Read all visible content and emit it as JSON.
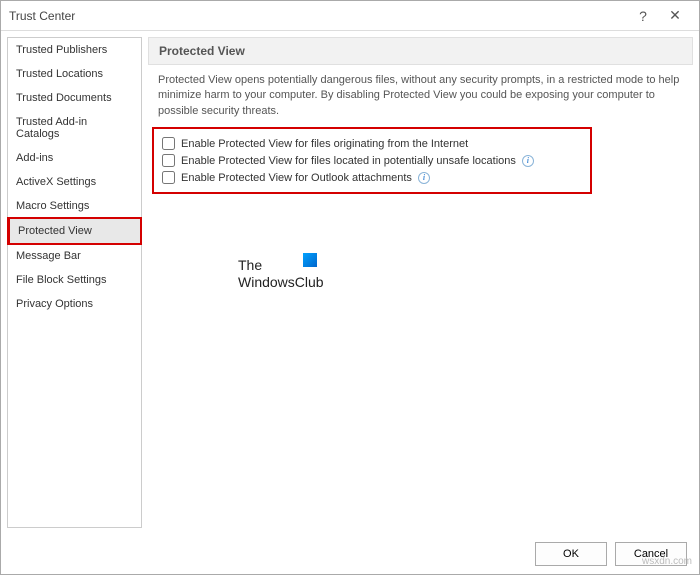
{
  "window": {
    "title": "Trust Center",
    "help": "?",
    "close": "✕"
  },
  "sidebar": {
    "items": [
      {
        "label": "Trusted Publishers"
      },
      {
        "label": "Trusted Locations"
      },
      {
        "label": "Trusted Documents"
      },
      {
        "label": "Trusted Add-in Catalogs"
      },
      {
        "label": "Add-ins"
      },
      {
        "label": "ActiveX Settings"
      },
      {
        "label": "Macro Settings"
      },
      {
        "label": "Protected View"
      },
      {
        "label": "Message Bar"
      },
      {
        "label": "File Block Settings"
      },
      {
        "label": "Privacy Options"
      }
    ],
    "selectedIndex": 7
  },
  "section": {
    "title": "Protected View",
    "description": "Protected View opens potentially dangerous files, without any security prompts, in a restricted mode to help minimize harm to your computer. By disabling Protected View you could be exposing your computer to possible security threats.",
    "options": [
      {
        "label": "Enable Protected View for files originating from the Internet",
        "checked": false,
        "info": false
      },
      {
        "label": "Enable Protected View for files located in potentially unsafe locations",
        "checked": false,
        "info": true
      },
      {
        "label": "Enable Protected View for Outlook attachments",
        "checked": false,
        "info": true
      }
    ]
  },
  "watermark": {
    "line1": "The",
    "line2": "WindowsClub"
  },
  "footer": {
    "ok": "OK",
    "cancel": "Cancel"
  },
  "credit": "wsxdn.com"
}
